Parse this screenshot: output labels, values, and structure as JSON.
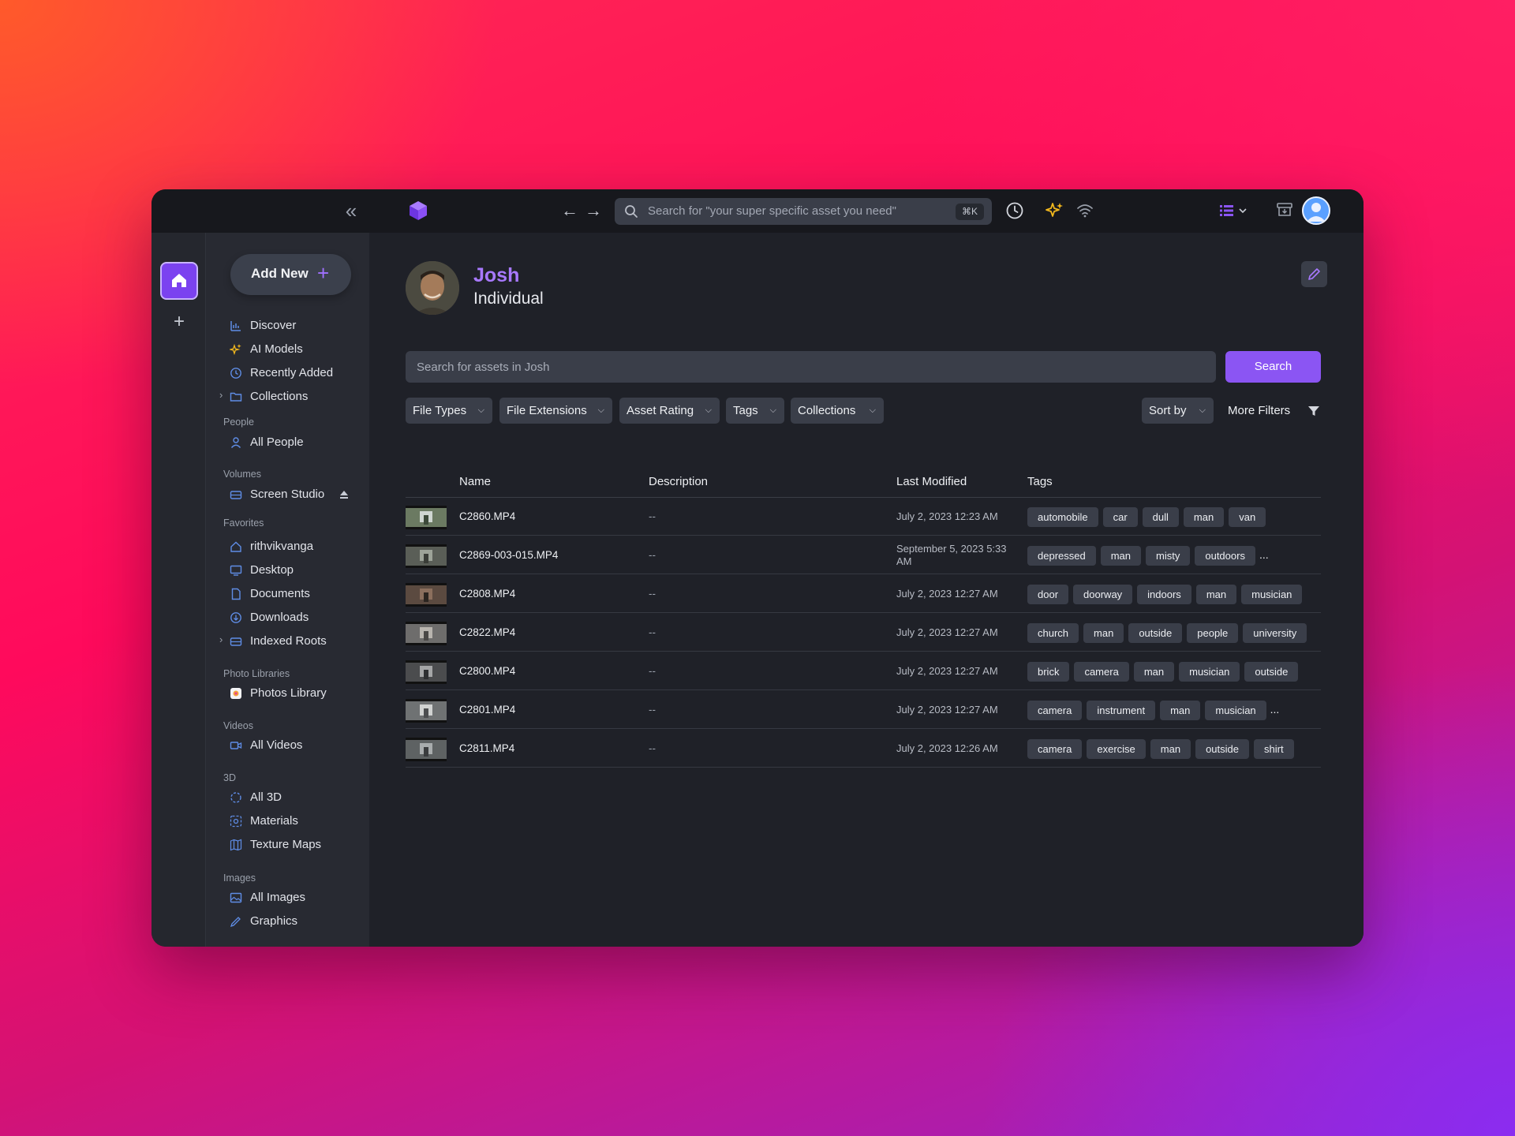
{
  "topbar": {
    "search_placeholder": "Search for \"your super specific asset you need\"",
    "shortcut": "⌘K"
  },
  "sidebar": {
    "add_new": "Add New",
    "main_items": [
      {
        "label": "Discover",
        "icon": "discover-icon"
      },
      {
        "label": "AI Models",
        "icon": "sparkle-icon"
      },
      {
        "label": "Recently Added",
        "icon": "clock-icon"
      },
      {
        "label": "Collections",
        "icon": "folder-icon"
      }
    ],
    "sections": {
      "people": {
        "title": "People",
        "items": [
          "All People"
        ]
      },
      "volumes": {
        "title": "Volumes",
        "items": [
          "Screen Studio"
        ]
      },
      "favorites": {
        "title": "Favorites",
        "items": [
          "rithvikvanga",
          "Desktop",
          "Documents",
          "Downloads",
          "Indexed Roots"
        ]
      },
      "photo_libraries": {
        "title": "Photo Libraries",
        "items": [
          "Photos Library"
        ]
      },
      "videos": {
        "title": "Videos",
        "items": [
          "All Videos"
        ]
      },
      "three_d": {
        "title": "3D",
        "items": [
          "All 3D",
          "Materials",
          "Texture Maps"
        ]
      },
      "images": {
        "title": "Images",
        "items": [
          "All Images",
          "Graphics"
        ]
      }
    }
  },
  "person": {
    "name": "Josh",
    "type": "Individual"
  },
  "asset_search": {
    "placeholder": "Search for assets in Josh",
    "button": "Search"
  },
  "filters": {
    "file_types": "File Types",
    "file_extensions": "File Extensions",
    "asset_rating": "Asset Rating",
    "tags": "Tags",
    "collections": "Collections",
    "sort_by": "Sort by",
    "more_filters": "More Filters"
  },
  "table": {
    "columns": [
      "Name",
      "Description",
      "Last Modified",
      "Tags"
    ],
    "rows": [
      {
        "name": "C2860.MP4",
        "description": "--",
        "modified": "July 2, 2023 12:23 AM",
        "tags": [
          "automobile",
          "car",
          "dull",
          "man",
          "van"
        ],
        "more": ""
      },
      {
        "name": "C2869-003-015.MP4",
        "description": "--",
        "modified": "September 5, 2023 5:33 AM",
        "tags": [
          "depressed",
          "man",
          "misty",
          "outdoors"
        ],
        "more": "..."
      },
      {
        "name": "C2808.MP4",
        "description": "--",
        "modified": "July 2, 2023 12:27 AM",
        "tags": [
          "door",
          "doorway",
          "indoors",
          "man",
          "musician"
        ],
        "more": ""
      },
      {
        "name": "C2822.MP4",
        "description": "--",
        "modified": "July 2, 2023 12:27 AM",
        "tags": [
          "church",
          "man",
          "outside",
          "people",
          "university"
        ],
        "more": ""
      },
      {
        "name": "C2800.MP4",
        "description": "--",
        "modified": "July 2, 2023 12:27 AM",
        "tags": [
          "brick",
          "camera",
          "man",
          "musician",
          "outside"
        ],
        "more": ""
      },
      {
        "name": "C2801.MP4",
        "description": "--",
        "modified": "July 2, 2023 12:27 AM",
        "tags": [
          "camera",
          "instrument",
          "man",
          "musician"
        ],
        "more": "..."
      },
      {
        "name": "C2811.MP4",
        "description": "--",
        "modified": "July 2, 2023 12:26 AM",
        "tags": [
          "camera",
          "exercise",
          "man",
          "outside",
          "shirt"
        ],
        "more": ""
      }
    ]
  },
  "colors": {
    "accent": "#8b55f3",
    "accent_text": "#a879ff",
    "window_bg": "#1f2128",
    "sidebar_bg": "#282a32",
    "chip_bg": "#3a3e49"
  }
}
